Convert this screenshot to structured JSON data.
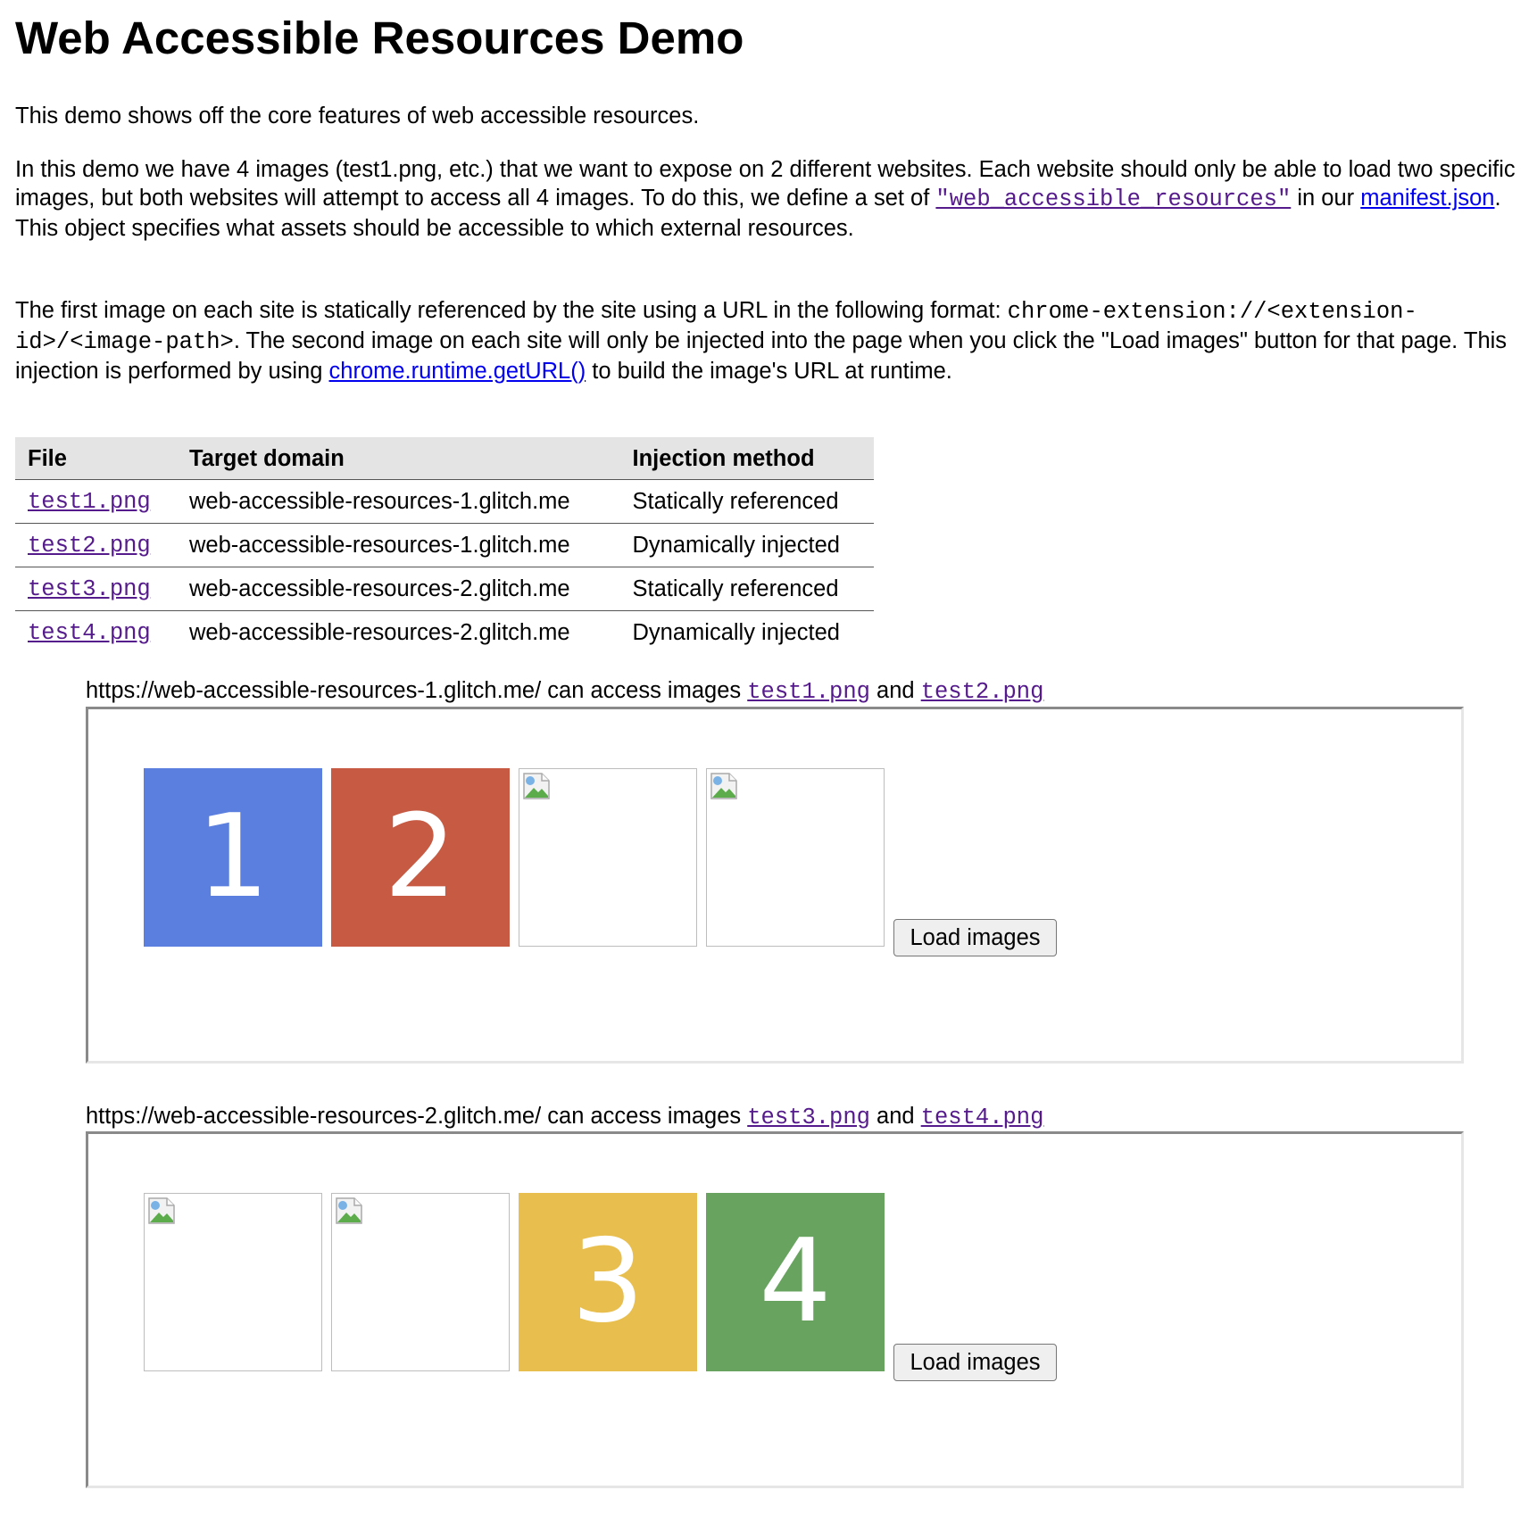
{
  "title": "Web Accessible Resources Demo",
  "intro": "This demo shows off the core features of web accessible resources.",
  "para2": {
    "text1": "In this demo we have 4 images (test1.png, etc.) that we want to expose on 2 different websites. Each website should only be able to load two specific images, but both websites will attempt to access all 4 images. To do this, we define a set of ",
    "war_link": "\"web_accessible_resources\"",
    "text2": " in our ",
    "manifest_link": "manifest.json",
    "text3": ". This object specifies what assets should be accessible to which external resources."
  },
  "para3": {
    "text1": "The first image on each site is statically referenced by the site using a URL in the following format: ",
    "code": "chrome-extension://<extension-id>/<image-path>",
    "text2": ". The second image on each site will only be injected into the page when you click the \"Load images\" button for that page. This injection is performed by using ",
    "runtime_link": "chrome.runtime.getURL()",
    "text3": " to build the image's URL at runtime."
  },
  "table": {
    "headers": [
      "File",
      "Target domain",
      "Injection method"
    ],
    "rows": [
      {
        "file": "test1.png",
        "domain": "web-accessible-resources-1.glitch.me",
        "method": "Statically referenced"
      },
      {
        "file": "test2.png",
        "domain": "web-accessible-resources-1.glitch.me",
        "method": "Dynamically injected"
      },
      {
        "file": "test3.png",
        "domain": "web-accessible-resources-2.glitch.me",
        "method": "Statically referenced"
      },
      {
        "file": "test4.png",
        "domain": "web-accessible-resources-2.glitch.me",
        "method": "Dynamically injected"
      }
    ]
  },
  "sites": [
    {
      "url": "https://web-accessible-resources-1.glitch.me/",
      "text": " can access images ",
      "img_a": "test1.png",
      "and": " and ",
      "img_b": "test2.png",
      "tiles": [
        {
          "status": "loaded",
          "label": "1",
          "color": "#5b7fde"
        },
        {
          "status": "loaded",
          "label": "2",
          "color": "#c65a43"
        },
        {
          "status": "broken"
        },
        {
          "status": "broken"
        }
      ],
      "button": "Load images"
    },
    {
      "url": "https://web-accessible-resources-2.glitch.me/",
      "text": " can access images ",
      "img_a": "test3.png",
      "and": " and ",
      "img_b": "test4.png",
      "tiles": [
        {
          "status": "broken"
        },
        {
          "status": "broken"
        },
        {
          "status": "loaded",
          "label": "3",
          "color": "#e8bf4f"
        },
        {
          "status": "loaded",
          "label": "4",
          "color": "#68a360"
        }
      ],
      "button": "Load images"
    }
  ]
}
